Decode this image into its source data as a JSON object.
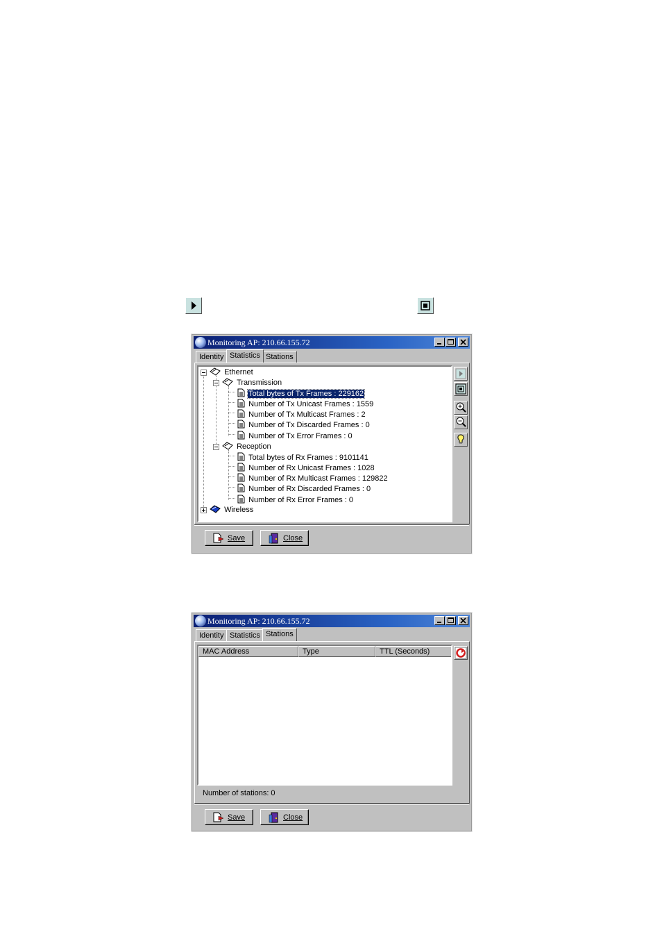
{
  "windows": [
    {
      "title": "Monitoring AP: 210.66.155.72",
      "tabs": [
        "Identity",
        "Statistics",
        "Stations"
      ],
      "active_tab": "Statistics",
      "tree": {
        "ethernet": "Ethernet",
        "transmission": "Transmission",
        "tx_items": [
          "Total bytes of Tx Frames : 229162",
          "Number of Tx Unicast Frames : 1559",
          "Number of Tx Multicast Frames : 2",
          "Number of Tx Discarded Frames : 0",
          "Number of Tx Error Frames : 0"
        ],
        "reception": "Reception",
        "rx_items": [
          "Total bytes of Rx Frames : 9101141",
          "Number of Rx Unicast Frames : 1028",
          "Number of Rx Multicast Frames : 129822",
          "Number of Rx Discarded Frames : 0",
          "Number of Rx Error Frames : 0"
        ],
        "wireless": "Wireless",
        "selected": "Total bytes of Tx Frames : 229162"
      },
      "buttons": {
        "save": "Save",
        "close": "Close"
      }
    },
    {
      "title": "Monitoring AP: 210.66.155.72",
      "tabs": [
        "Identity",
        "Statistics",
        "Stations"
      ],
      "active_tab": "Stations",
      "columns": [
        "MAC Address",
        "Type",
        "TTL (Seconds)"
      ],
      "status": "Number of stations: 0",
      "buttons": {
        "save": "Save",
        "close": "Close"
      }
    }
  ],
  "icons": {
    "floating": [
      "play-icon",
      "stop-icon"
    ],
    "toolbar": [
      "play-icon",
      "stop-icon",
      "zoom-in-icon",
      "zoom-out-icon",
      "lightbulb-icon"
    ],
    "refresh": "refresh-icon"
  },
  "colors": {
    "titlebar_start": "#0a1e73",
    "titlebar_end": "#4e86d8",
    "selection": "#0a246a",
    "face": "#c0c0c0",
    "icon_tint": "#c9e2e0"
  }
}
